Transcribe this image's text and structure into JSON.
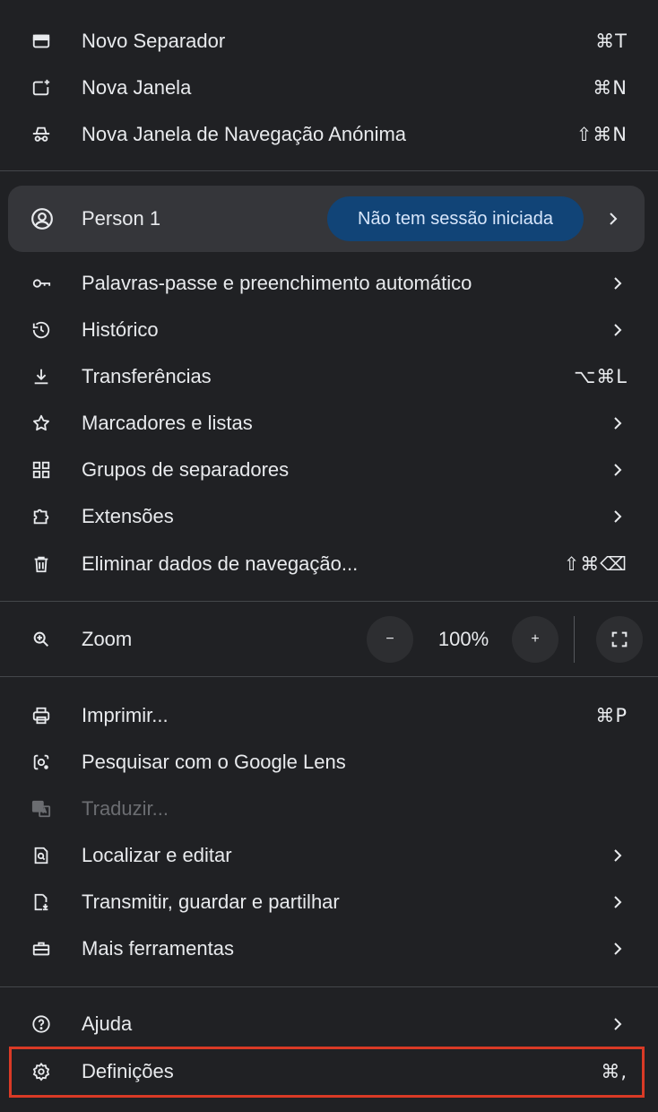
{
  "menu": {
    "new_tab": {
      "label": "Novo Separador",
      "shortcut": "⌘T",
      "icon": "new-tab-icon"
    },
    "new_window": {
      "label": "Nova Janela",
      "shortcut": "⌘N",
      "icon": "new-window-icon"
    },
    "incognito": {
      "label": "Nova Janela de Navegação Anónima",
      "shortcut": "⇧⌘N",
      "icon": "incognito-icon"
    },
    "profile": {
      "name": "Person 1",
      "status": "Não tem sessão iniciada",
      "icon": "account-circle-icon",
      "badge_color": "#114477"
    },
    "passwords": {
      "label": "Palavras-passe e preenchimento automático",
      "icon": "key-icon"
    },
    "history": {
      "label": "Histórico",
      "icon": "history-icon"
    },
    "downloads": {
      "label": "Transferências",
      "shortcut": "⌥⌘L",
      "icon": "download-icon"
    },
    "bookmarks": {
      "label": "Marcadores e listas",
      "icon": "star-icon"
    },
    "tab_groups": {
      "label": "Grupos de separadores",
      "icon": "tab-groups-icon"
    },
    "extensions": {
      "label": "Extensões",
      "icon": "puzzle-icon"
    },
    "clear_data": {
      "label": "Eliminar dados de navegação...",
      "shortcut": "⇧⌘⌫",
      "icon": "trash-icon"
    },
    "zoom": {
      "label": "Zoom",
      "value": "100%",
      "decrease": "−",
      "increase": "+",
      "icon": "zoom-icon"
    },
    "print": {
      "label": "Imprimir...",
      "shortcut": "⌘P",
      "icon": "print-icon"
    },
    "lens": {
      "label": "Pesquisar com o Google Lens",
      "icon": "google-lens-icon"
    },
    "translate": {
      "label": "Traduzir...",
      "icon": "translate-icon",
      "disabled": true
    },
    "find_edit": {
      "label": "Localizar e editar",
      "icon": "find-icon"
    },
    "cast_save_share": {
      "label": "Transmitir, guardar e partilhar",
      "icon": "cast-save-icon"
    },
    "more_tools": {
      "label": "Mais ferramentas",
      "icon": "toolbox-icon"
    },
    "help": {
      "label": "Ajuda",
      "icon": "help-icon"
    },
    "settings": {
      "label": "Definições",
      "shortcut": "⌘,",
      "icon": "settings-icon"
    }
  },
  "colors": {
    "background": "#202124",
    "text": "#e8eaed",
    "disabled_text": "#6b6d71",
    "profile_bg": "#35363a",
    "highlight_border": "#d93a26"
  }
}
